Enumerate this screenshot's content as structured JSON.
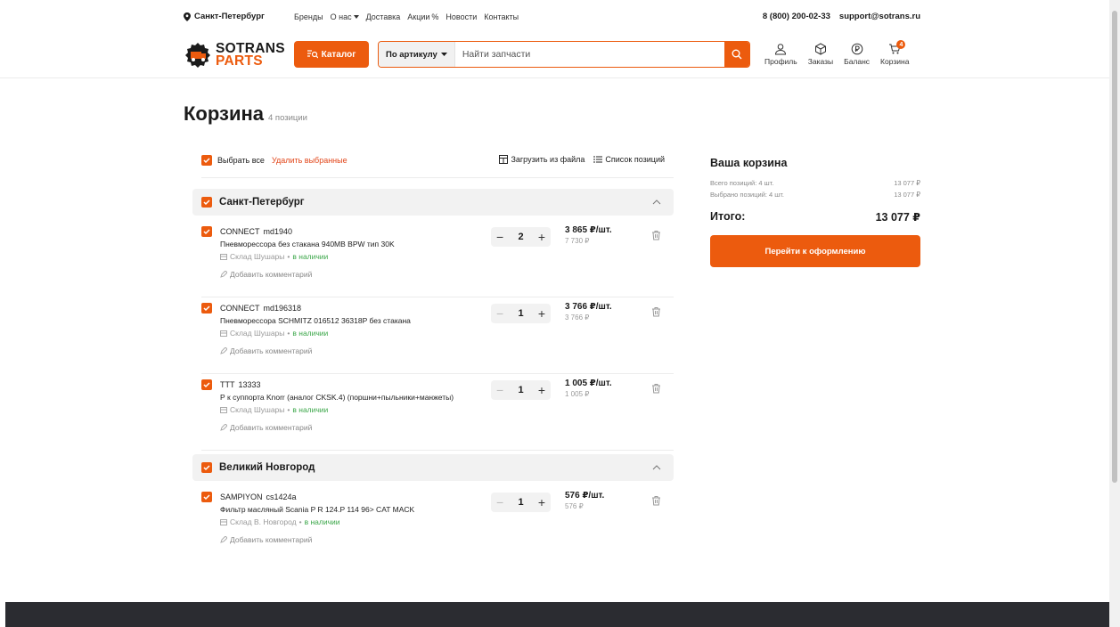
{
  "topbar": {
    "city": "Санкт-Петербург",
    "nav": [
      "Бренды",
      "О нас",
      "Доставка",
      "Акции",
      "Новости",
      "Контакты"
    ],
    "phone": "8 (800) 200-02-33",
    "email": "support@sotrans.ru"
  },
  "header": {
    "logo_line1": "SOTRANS",
    "logo_line2": "PARTS",
    "catalog_label": "Каталог",
    "search_mode": "По артикулу",
    "search_placeholder": "Найти запчасти",
    "icons": {
      "profile": "Профиль",
      "orders": "Заказы",
      "balance": "Баланс",
      "cart": "Корзина",
      "cart_badge": "4"
    }
  },
  "page": {
    "title": "Корзина",
    "count": "4 позиции"
  },
  "toolbar": {
    "select_all": "Выбрать все",
    "delete_selected": "Удалить выбранные",
    "upload": "Загрузить из файла",
    "list": "Список позиций"
  },
  "groups": [
    {
      "name": "Санкт-Петербург",
      "items": [
        {
          "brand": "CONNECT",
          "article": "md1940",
          "name": "Пневморессора без стакана 940MB BPW тип 30K",
          "warehouse": "Склад Шушары",
          "availability": "в наличии",
          "comment": "Добавить комментарий",
          "qty": "2",
          "unit_price": "3 865 ₽/шт.",
          "total": "7 730 ₽"
        },
        {
          "brand": "CONNECT",
          "article": "md196318",
          "name": "Пневморессора SCHMITZ 016512 36318P без стакана",
          "warehouse": "Склад Шушары",
          "availability": "в наличии",
          "comment": "Добавить комментарий",
          "qty": "1",
          "unit_price": "3 766 ₽/шт.",
          "total": "3 766 ₽"
        },
        {
          "brand": "TTT",
          "article": "13333",
          "name": "Р к суппорта Knorr (аналог CKSK.4) (поршни+пыльники+манжеты)",
          "warehouse": "Склад Шушары",
          "availability": "в наличии",
          "comment": "Добавить комментарий",
          "qty": "1",
          "unit_price": "1 005 ₽/шт.",
          "total": "1 005 ₽"
        }
      ]
    },
    {
      "name": "Великий Новгород",
      "items": [
        {
          "brand": "SAMPIYON",
          "article": "cs1424a",
          "name": "Фильтр масляный Scania P R 124.P 114 96> CAT MACK",
          "warehouse": "Склад В. Новгород",
          "availability": "в наличии",
          "comment": "Добавить комментарий",
          "qty": "1",
          "unit_price": "576 ₽/шт.",
          "total": "576 ₽"
        }
      ]
    }
  ],
  "summary": {
    "title": "Ваша корзина",
    "total_positions_label": "Всего позиций: 4 шт.",
    "total_positions_value": "13 077 ₽",
    "selected_label": "Выбрано позиций: 4 шт.",
    "selected_value": "13 077 ₽",
    "grand_label": "Итого:",
    "grand_value": "13 077 ₽",
    "checkout_label": "Перейти к оформлению"
  },
  "colors": {
    "accent": "#ec5b0e",
    "in_stock": "#3aa648",
    "delete": "#e2471b",
    "footer": "#2b2c31"
  }
}
